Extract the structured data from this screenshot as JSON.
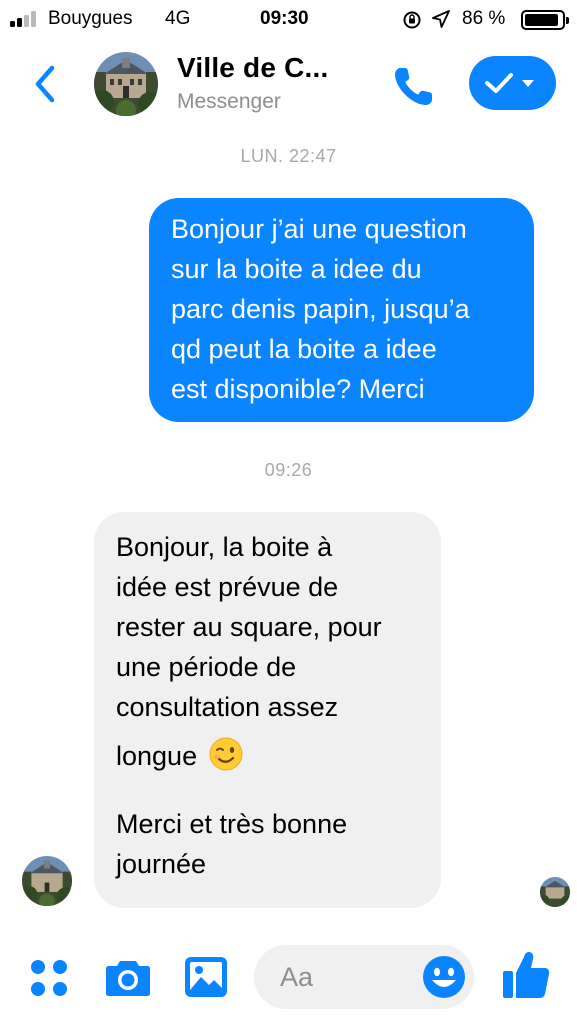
{
  "status_bar": {
    "carrier": "Bouygues",
    "network": "4G",
    "time": "09:30",
    "battery_percent": "86 %"
  },
  "header": {
    "contact_name": "Ville de C...",
    "contact_subtitle": "Messenger",
    "icons": [
      "chevron-left-icon",
      "phone-icon",
      "checkmark-icon",
      "caret-down-icon"
    ],
    "accent_color": "#0a84ff"
  },
  "conversation": {
    "timestamp_1": "LUN. 22:47",
    "outgoing_message": {
      "lines": [
        "Bonjour j’ai une question",
        "sur la boite a idee du",
        "parc denis papin, jusqu’a",
        "qd peut la boite a idee",
        "est disponible? Merci"
      ]
    },
    "timestamp_2": "09:26",
    "incoming_message": {
      "lines": [
        "Bonjour, la boite à",
        "idée est prévue de",
        "rester au square, pour",
        "une période de",
        "consultation assez",
        "longue"
      ],
      "emoji": "winking-face",
      "closing_lines": [
        "Merci et très bonne",
        "journée"
      ]
    }
  },
  "composer": {
    "placeholder": "Aa",
    "icons": [
      "apps-icon",
      "camera-icon",
      "image-icon",
      "emoji-icon",
      "thumbs-up-icon"
    ]
  }
}
